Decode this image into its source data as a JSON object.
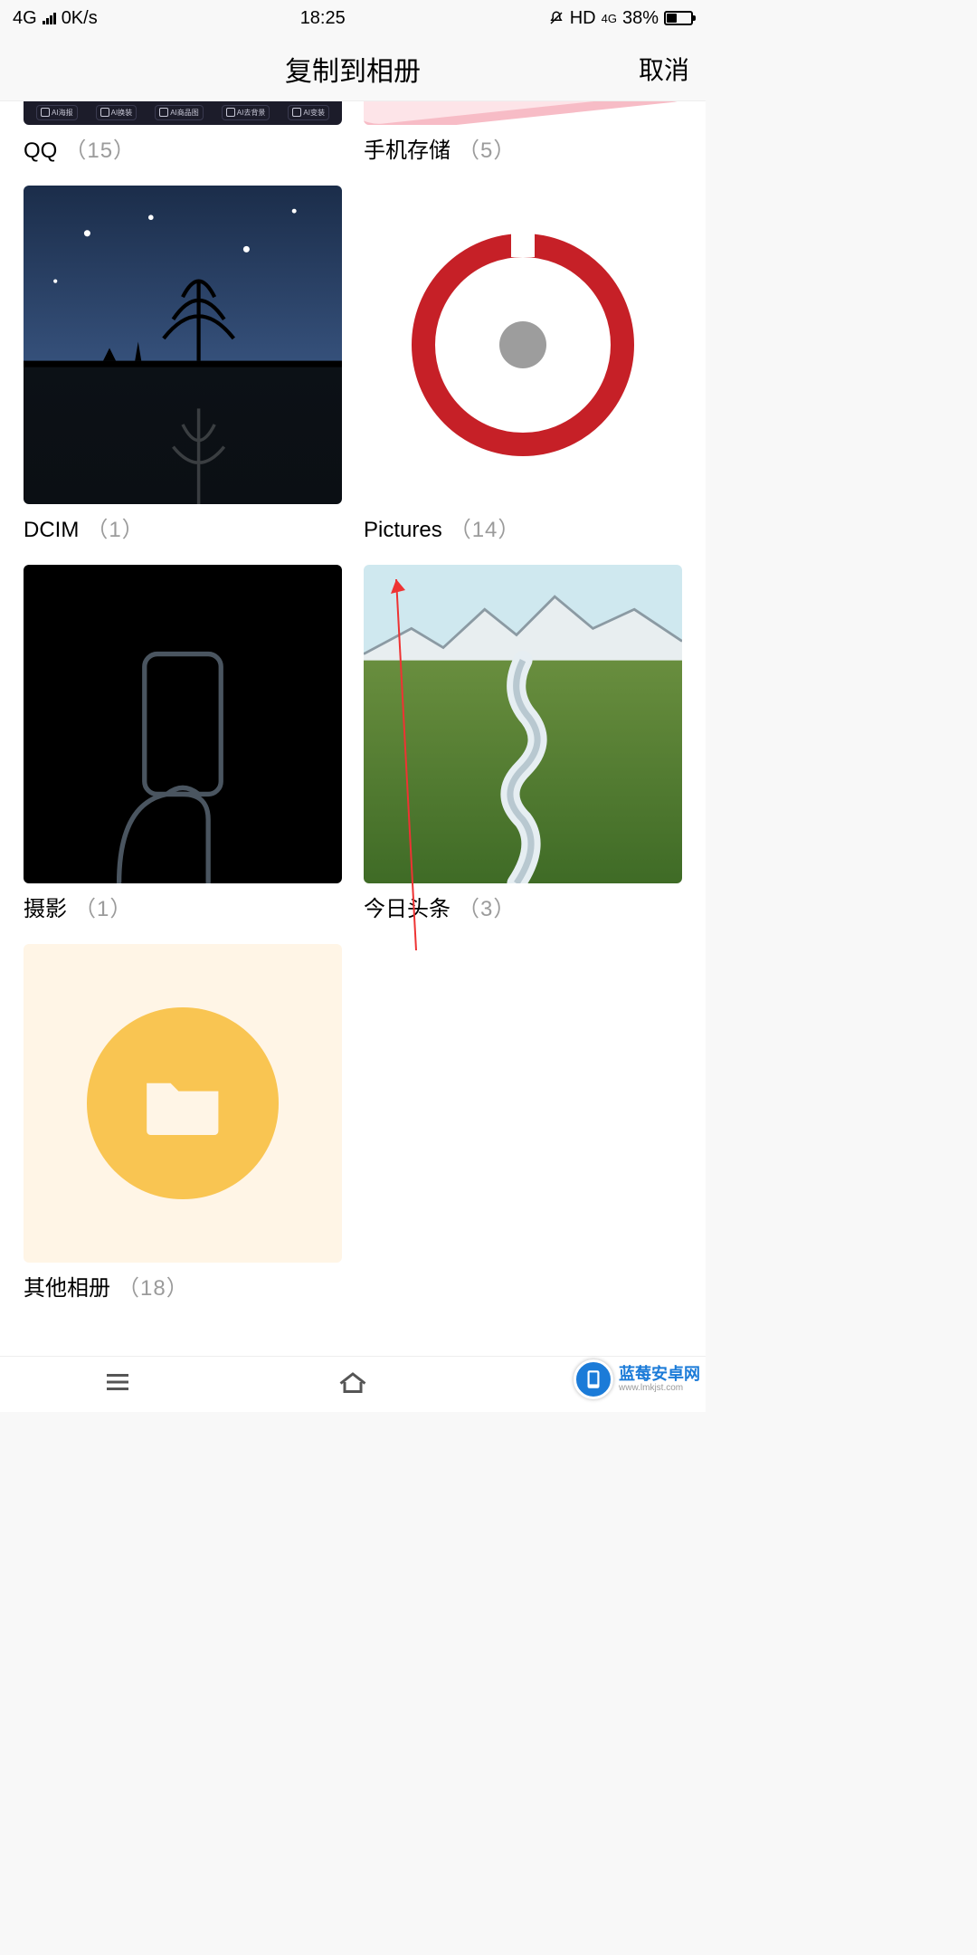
{
  "status": {
    "network": "4G",
    "speed": "0K/s",
    "time": "18:25",
    "hd": "HD",
    "data": "4G",
    "battery_pct": "38%"
  },
  "header": {
    "title": "复制到相册",
    "cancel": "取消"
  },
  "albums": [
    {
      "name": "QQ",
      "count": "（15）"
    },
    {
      "name": "手机存储",
      "count": "（5）"
    },
    {
      "name": "DCIM",
      "count": "（1）"
    },
    {
      "name": "Pictures",
      "count": "（14）"
    },
    {
      "name": "摄影",
      "count": "（1）"
    },
    {
      "name": "今日头条",
      "count": "（3）"
    },
    {
      "name": "其他相册",
      "count": "（18）"
    }
  ],
  "qq_chips": [
    "AI海报",
    "AI换装",
    "AI商品图",
    "AI去背景",
    "AI变装"
  ],
  "watermark": {
    "name": "蓝莓安卓网",
    "url": "www.lmkjst.com"
  }
}
